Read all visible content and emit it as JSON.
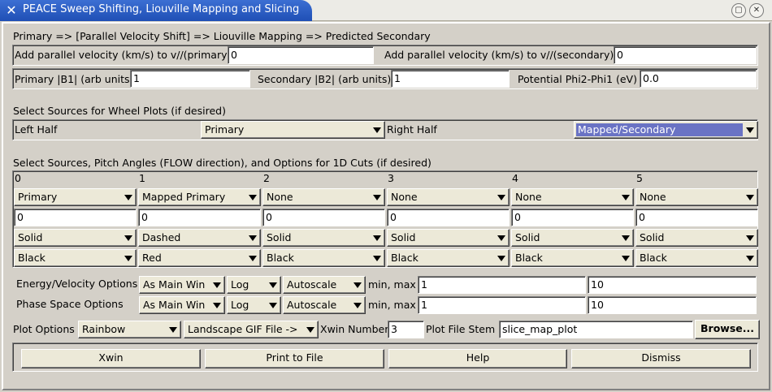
{
  "window": {
    "title": "PEACE Sweep Shifting, Liouville Mapping and Slicing",
    "icon": "x-app-icon",
    "controls": {
      "minimize": "▢",
      "close": "✕"
    }
  },
  "mapping": {
    "header": "Primary => [Parallel Velocity Shift] => Liouville Mapping => Predicted Secondary",
    "add_vpar_primary_label": "Add parallel velocity (km/s) to v//(primary)",
    "add_vpar_primary_value": "0",
    "add_vpar_secondary_label": "Add parallel velocity (km/s) to v//(secondary)",
    "add_vpar_secondary_value": "0",
    "b1_label": "Primary |B1| (arb units)",
    "b1_value": "1",
    "b2_label": "Secondary |B2| (arb units)",
    "b2_value": "1",
    "phi_label": "Potential Phi2-Phi1 (eV)",
    "phi_value": "0.0"
  },
  "wheel": {
    "header": "Select Sources for Wheel Plots (if desired)",
    "left_label": "Left Half",
    "left_value": "Primary",
    "right_label": "Right Half",
    "right_value": "Mapped/Secondary"
  },
  "cuts": {
    "header": "Select Sources, Pitch Angles (FLOW direction), and Options for 1D Cuts (if desired)",
    "columns": [
      {
        "index": "0",
        "source": "Primary",
        "pitch": "0",
        "line": "Solid",
        "color": "Black"
      },
      {
        "index": "1",
        "source": "Mapped Primary",
        "pitch": "0",
        "line": "Dashed",
        "color": "Red"
      },
      {
        "index": "2",
        "source": "None",
        "pitch": "0",
        "line": "Solid",
        "color": "Black"
      },
      {
        "index": "3",
        "source": "None",
        "pitch": "0",
        "line": "Solid",
        "color": "Black"
      },
      {
        "index": "4",
        "source": "None",
        "pitch": "0",
        "line": "Solid",
        "color": "Black"
      },
      {
        "index": "5",
        "source": "None",
        "pitch": "0",
        "line": "Solid",
        "color": "Black"
      }
    ]
  },
  "energy": {
    "label": "Energy/Velocity Options",
    "mode": "As Main Win",
    "scale": "Log",
    "range_mode": "Autoscale",
    "minmax_label": "min, max",
    "min": "1",
    "max": "10"
  },
  "phase": {
    "label": "Phase Space Options",
    "mode": "As Main Win",
    "scale": "Log",
    "range_mode": "Autoscale",
    "minmax_label": "min, max",
    "min": "1",
    "max": "10"
  },
  "plot": {
    "label": "Plot Options",
    "colormap": "Rainbow",
    "output": "Landscape GIF File ->",
    "xwin_label": "Xwin Number",
    "xwin_value": "3",
    "stem_label": "Plot File Stem",
    "stem_value": "slice_map_plot",
    "browse_label": "Browse..."
  },
  "actions": {
    "xwin": "Xwin",
    "print": "Print to File",
    "help": "Help",
    "dismiss": "Dismiss"
  }
}
